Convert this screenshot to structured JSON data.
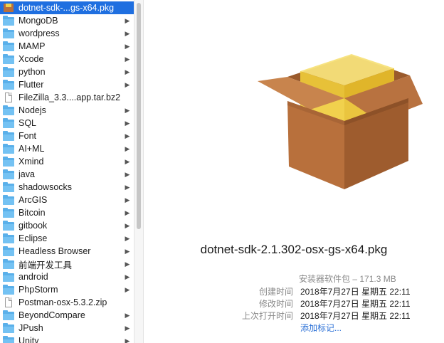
{
  "column": {
    "items": [
      {
        "name": "dotnet-sdk-...gs-x64.pkg",
        "type": "package",
        "selected": true,
        "has_children": false
      },
      {
        "name": "MongoDB",
        "type": "folder",
        "has_children": true
      },
      {
        "name": "wordpress",
        "type": "folder",
        "has_children": true
      },
      {
        "name": "MAMP",
        "type": "folder",
        "has_children": true
      },
      {
        "name": "Xcode",
        "type": "folder",
        "has_children": true
      },
      {
        "name": "python",
        "type": "folder",
        "has_children": true
      },
      {
        "name": "Flutter",
        "type": "folder",
        "has_children": true
      },
      {
        "name": "FileZilla_3.3....app.tar.bz2",
        "type": "document",
        "has_children": false
      },
      {
        "name": "Nodejs",
        "type": "folder",
        "has_children": true
      },
      {
        "name": "SQL",
        "type": "folder",
        "has_children": true
      },
      {
        "name": "Font",
        "type": "folder",
        "has_children": true
      },
      {
        "name": "AI+ML",
        "type": "folder",
        "has_children": true
      },
      {
        "name": "Xmind",
        "type": "folder",
        "has_children": true
      },
      {
        "name": "java",
        "type": "folder",
        "has_children": true
      },
      {
        "name": "shadowsocks",
        "type": "folder",
        "has_children": true
      },
      {
        "name": "ArcGIS",
        "type": "folder",
        "has_children": true
      },
      {
        "name": "Bitcoin",
        "type": "folder",
        "has_children": true
      },
      {
        "name": "gitbook",
        "type": "folder",
        "has_children": true
      },
      {
        "name": "Eclipse",
        "type": "folder",
        "has_children": true
      },
      {
        "name": "Headless Browser",
        "type": "folder",
        "has_children": true
      },
      {
        "name": "前端开发工具",
        "type": "folder",
        "has_children": true
      },
      {
        "name": "android",
        "type": "folder",
        "has_children": true
      },
      {
        "name": "PhpStorm",
        "type": "folder",
        "has_children": true
      },
      {
        "name": "Postman-osx-5.3.2.zip",
        "type": "document",
        "has_children": false
      },
      {
        "name": "BeyondCompare",
        "type": "folder",
        "has_children": true
      },
      {
        "name": "JPush",
        "type": "folder",
        "has_children": true
      },
      {
        "name": "Unity",
        "type": "folder",
        "has_children": true
      }
    ]
  },
  "preview": {
    "icon": "package-box-icon",
    "file_name": "dotnet-sdk-2.1.302-osx-gs-x64.pkg",
    "kind": "安装器软件包 – 171.3 MB",
    "meta": [
      {
        "label": "创建时间",
        "value": "2018年7月27日 星期五 22:11"
      },
      {
        "label": "修改时间",
        "value": "2018年7月27日 星期五 22:11"
      },
      {
        "label": "上次打开时间",
        "value": "2018年7月27日 星期五 22:11"
      }
    ],
    "add_tags": "添加标记..."
  },
  "colors": {
    "selection": "#1f6fe0",
    "folder": "#5ab0ea",
    "link": "#2a6fd6",
    "label_gray": "#8a8a8a"
  }
}
